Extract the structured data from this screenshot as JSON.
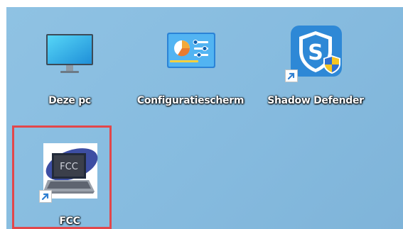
{
  "desktop": {
    "icons": [
      {
        "label": "Deze pc",
        "icon": "monitor-icon"
      },
      {
        "label": "Configuratiescherm",
        "icon": "control-panel-icon"
      },
      {
        "label": "Shadow Defender",
        "icon": "shadow-defender-shield-icon",
        "shortcut": true
      },
      {
        "label": "FCC",
        "icon": "fcc-laptop-icon",
        "shortcut": true,
        "highlighted": true,
        "icon_text": "FCC"
      }
    ]
  },
  "colors": {
    "wallpaper": "#8fc2e3",
    "highlight_border": "#e2474b",
    "shortcut_arrow": "#2f7fd1"
  }
}
